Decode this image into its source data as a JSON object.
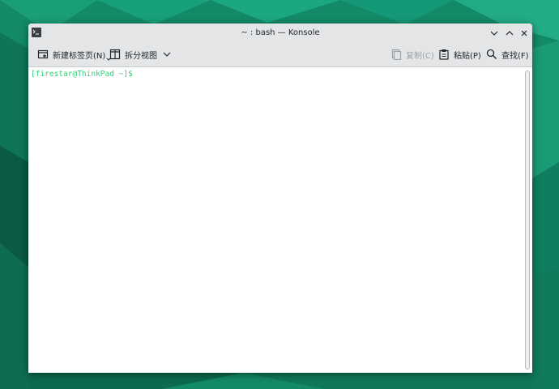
{
  "window": {
    "title": "~ : bash — Konsole"
  },
  "toolbar": {
    "new_tab_label": "新建标签页(N)",
    "split_view_label": "拆分视图",
    "copy_label": "复制(C)",
    "paste_label": "粘贴(P)",
    "find_label": "查找(F)"
  },
  "terminal": {
    "prompt": "[firestar@ThinkPad ~]$"
  },
  "colors": {
    "prompt": "#33d17a",
    "wallpaper": "#14805f"
  },
  "icons": {
    "app": "terminal-icon",
    "minimize": "chevron-down-icon",
    "maximize": "chevron-up-icon",
    "close": "close-icon",
    "new_tab": "new-tab-icon",
    "split": "split-view-icon",
    "copy": "copy-icon",
    "paste": "paste-icon",
    "find": "search-icon"
  }
}
